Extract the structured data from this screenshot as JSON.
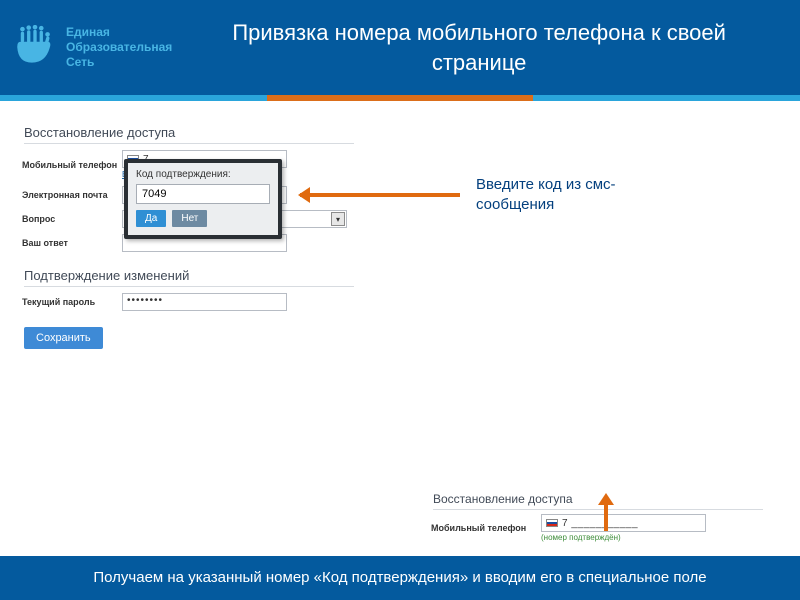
{
  "brand": {
    "line1": "Единая",
    "line2": "Образовательная",
    "line3": "Сеть"
  },
  "header_title": "Привязка номера мобильного телефона к своей странице",
  "callout": "Введите код из смс-сообщения",
  "footer_text": "Получаем на указанный номер «Код подтверждения» и вводим его в специальное поле",
  "form": {
    "section_access": "Восстановление доступа",
    "phone_label": "Мобильный телефон",
    "phone_value": "7 ___________",
    "confirm_link": "Ввести код подтверждения",
    "email_label": "Электронная почта",
    "question_label": "Вопрос",
    "answer_label": "Ваш ответ",
    "section_confirm": "Подтверждение изменений",
    "current_pwd_label": "Текущий пароль",
    "current_pwd_value": "••••••••",
    "save_label": "Сохранить"
  },
  "popup": {
    "label": "Код подтверждения:",
    "value": "7049",
    "yes": "Да",
    "no": "Нет"
  },
  "snippet": {
    "section_access": "Восстановление доступа",
    "phone_label": "Мобильный телефон",
    "phone_value": "7 ___________",
    "confirmed": "(номер подтверждён)"
  }
}
